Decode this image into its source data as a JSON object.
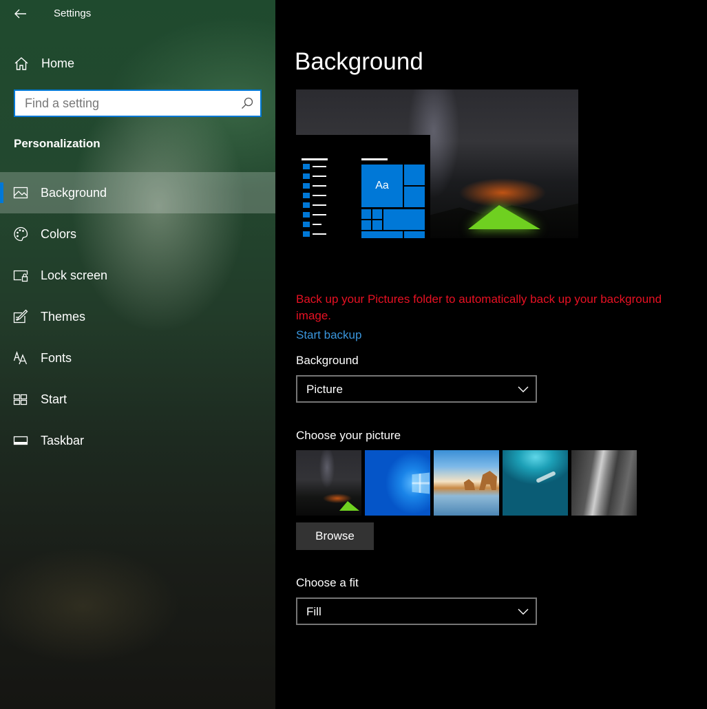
{
  "window": {
    "title": "Settings"
  },
  "sidebar": {
    "home_label": "Home",
    "search_placeholder": "Find a setting",
    "section_header": "Personalization",
    "items": [
      {
        "label": "Background",
        "icon": "picture-icon",
        "active": true
      },
      {
        "label": "Colors",
        "icon": "palette-icon",
        "active": false
      },
      {
        "label": "Lock screen",
        "icon": "lock-screen-icon",
        "active": false
      },
      {
        "label": "Themes",
        "icon": "themes-icon",
        "active": false
      },
      {
        "label": "Fonts",
        "icon": "fonts-icon",
        "active": false
      },
      {
        "label": "Start",
        "icon": "start-icon",
        "active": false
      },
      {
        "label": "Taskbar",
        "icon": "taskbar-icon",
        "active": false
      }
    ]
  },
  "main": {
    "title": "Background",
    "preview": {
      "tile_text": "Aa"
    },
    "backup_warning": "Back up your Pictures folder to automatically back up your background image.",
    "backup_link": "Start backup",
    "background_label": "Background",
    "background_value": "Picture",
    "choose_picture_label": "Choose your picture",
    "pictures": [
      "night-sky-tent-picture",
      "windows-logo-blue-picture",
      "beach-rocks-picture",
      "underwater-swimmer-picture",
      "rock-cliff-picture"
    ],
    "browse_label": "Browse",
    "fit_label": "Choose a fit",
    "fit_value": "Fill"
  },
  "colors": {
    "accent": "#0078d7",
    "warning": "#e81123",
    "link": "#3a96dd",
    "background": "#000000"
  }
}
